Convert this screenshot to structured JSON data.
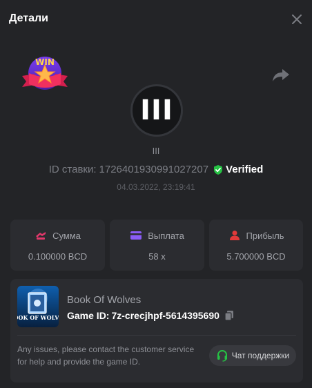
{
  "header": {
    "title": "Детали"
  },
  "game": {
    "logo_text": "III",
    "small_name": "III"
  },
  "bet": {
    "id_label": "ID ставки:",
    "id_value": "1726401930991027207",
    "verified_label": "Verified",
    "date": "04.03.2022, 23:19:41"
  },
  "badge": {
    "text": "WIN"
  },
  "stats": {
    "amount": {
      "label": "Сумма",
      "value": "0.100000 BCD"
    },
    "payout": {
      "label": "Выплата",
      "value": "58 x"
    },
    "profit": {
      "label": "Прибыль",
      "value": "5.700000 BCD"
    }
  },
  "card": {
    "game_title": "Book Of Wolves",
    "game_id_label": "Game ID:",
    "game_id_value": "7z-crecjhpf-5614395690",
    "help_text": "Any issues, please contact the customer service for help and provide the game ID.",
    "support_label": "Чат поддержки",
    "thumb_text": "BOOK OF WOLVES"
  },
  "colors": {
    "accent_green": "#26c244",
    "amount_icon": "#e2386b",
    "payout_icon": "#8a5cf6",
    "profit_icon": "#e23a3a"
  },
  "icons": [
    "close-icon",
    "share-icon",
    "verified-shield-icon",
    "amount-icon",
    "payout-card-icon",
    "profit-user-icon",
    "copy-icon",
    "headset-icon"
  ]
}
